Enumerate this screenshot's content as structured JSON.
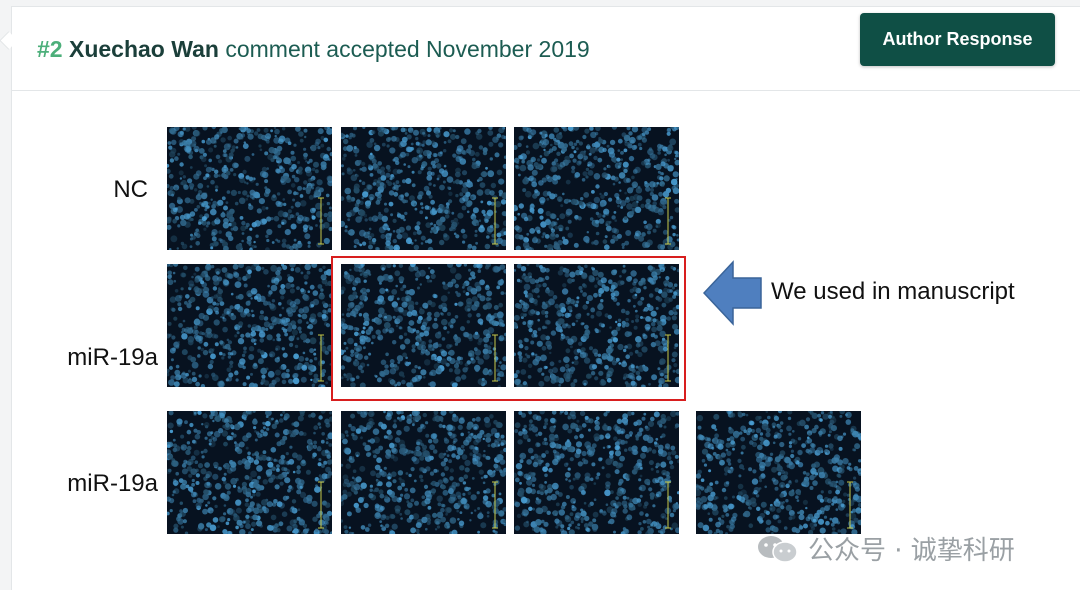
{
  "comment": {
    "number": "#2",
    "author": "Xuechao Wan",
    "status": "comment accepted November 2019"
  },
  "actions": {
    "author_response": "Author Response"
  },
  "figure": {
    "rows": [
      {
        "label": "NC"
      },
      {
        "label": "miR-19a"
      },
      {
        "label": "miR-19a"
      }
    ],
    "annotation": "We used in manuscript",
    "arrow_color": "#4f7fbf",
    "highlight_color": "#d81e1e"
  },
  "watermark": {
    "text": "公众号 · 诚挚科研",
    "icon": "wechat-icon"
  },
  "colors": {
    "brand": "#0f4f45",
    "accent": "#4caf7a",
    "title": "#1c5c52"
  }
}
